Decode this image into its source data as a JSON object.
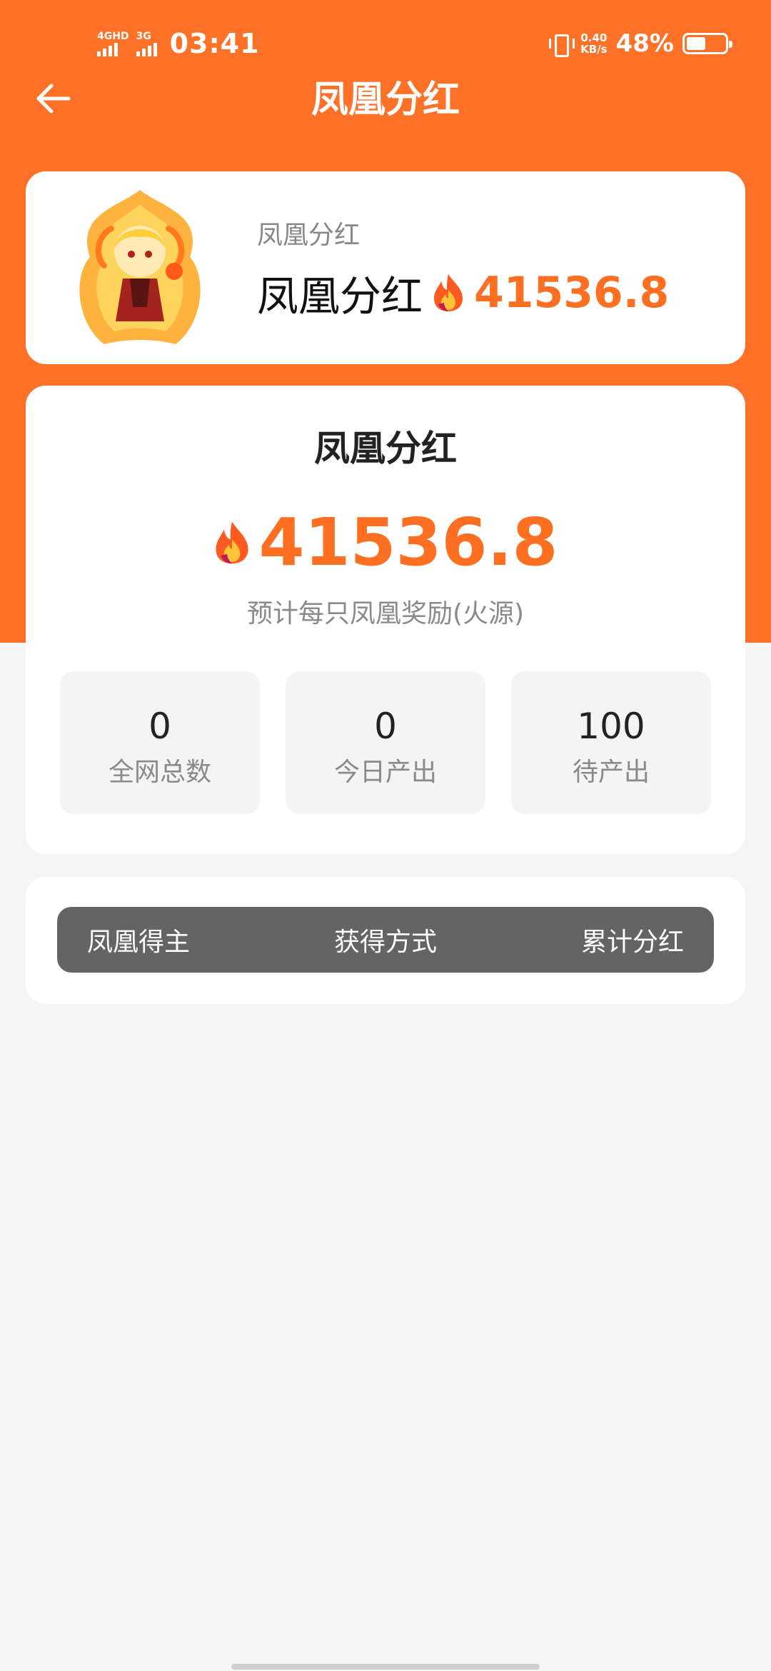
{
  "status_bar": {
    "net1": "4GHD",
    "net2": "3G",
    "time": "03:41",
    "speed_value": "0.40",
    "speed_unit": "KB/s",
    "battery": "48%"
  },
  "nav": {
    "title": "凤凰分红"
  },
  "summary_card": {
    "subtitle": "凤凰分红",
    "name": "凤凰分红",
    "value": "41536.8"
  },
  "reward_card": {
    "title": "凤凰分红",
    "value": "41536.8",
    "description": "预计每只凤凰奖励(火源)",
    "stats": [
      {
        "value": "0",
        "label": "全网总数"
      },
      {
        "value": "0",
        "label": "今日产出"
      },
      {
        "value": "100",
        "label": "待产出"
      }
    ]
  },
  "table_header": {
    "columns": [
      "凤凰得主",
      "获得方式",
      "累计分红"
    ]
  },
  "colors": {
    "accent": "#ff7126",
    "value": "#ff6f22",
    "header_bg": "#646464"
  },
  "icons": {
    "back": "arrow-left-icon",
    "currency": "flame-icon",
    "avatar": "phoenix-character-icon"
  }
}
